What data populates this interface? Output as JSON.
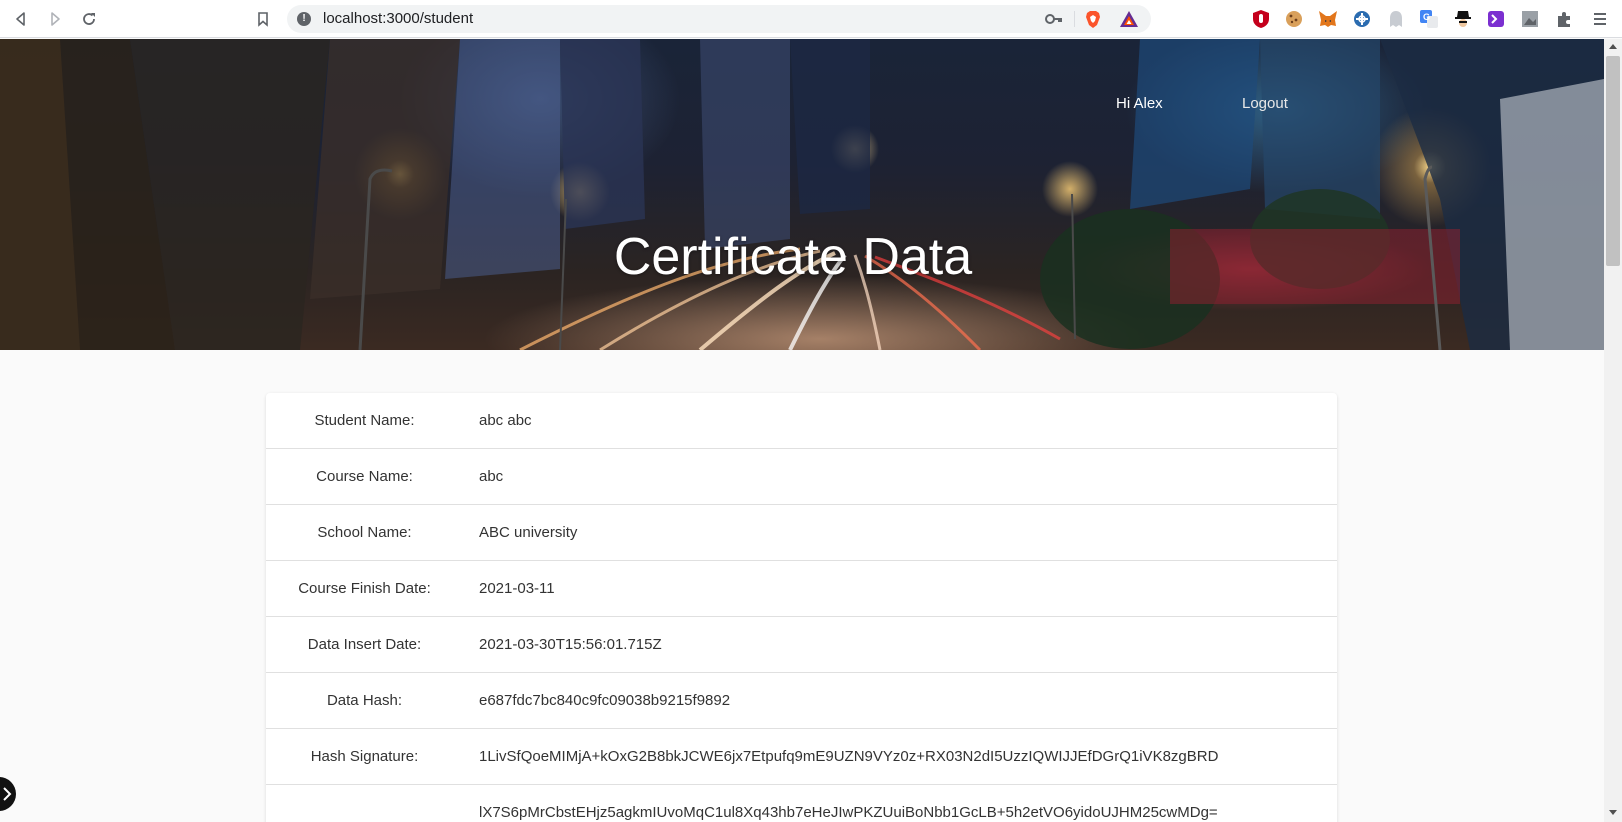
{
  "browser": {
    "url": "localhost:3000/student",
    "nav": {
      "back": "back-icon",
      "forward": "forward-icon",
      "reload": "reload-icon",
      "bookmark": "bookmark-icon"
    },
    "extensions": [
      "ublock-icon",
      "cookie-icon",
      "metamask-icon",
      "crosshair-icon",
      "ghost-icon",
      "translate-icon",
      "spy-icon",
      "terminal-icon",
      "image-icon",
      "puzzle-icon",
      "menu-icon"
    ]
  },
  "header": {
    "greeting": "Hi Alex",
    "logout": "Logout",
    "title": "Certificate Data"
  },
  "certificate": {
    "rows": [
      {
        "label": "Student Name:",
        "value": "abc abc"
      },
      {
        "label": "Course Name:",
        "value": "abc"
      },
      {
        "label": "School Name:",
        "value": "ABC university"
      },
      {
        "label": "Course Finish Date:",
        "value": "2021-03-11"
      },
      {
        "label": "Data Insert Date:",
        "value": "2021-03-30T15:56:01.715Z"
      },
      {
        "label": "Data Hash:",
        "value": "e687fdc7bc840c9fc09038b9215f9892"
      },
      {
        "label": "Hash Signature:",
        "value": "1LivSfQoeMIMjA+kOxG2B8bkJCWE6jx7Etpufq9mE9UZN9VYz0z+RX03N2dI5UzzIQWIJJEfDGrQ1iVK8zgBRD"
      },
      {
        "label": "",
        "value": "lX7S6pMrCbstEHjz5agkmIUvoMqC1ul8Xq43hb7eHeJIwPKZUuiBoNbb1GcLB+5h2etVO6yidoUJHM25cwMDg="
      }
    ]
  },
  "colors": {
    "accent": "#ffffff",
    "card_bg": "#ffffff",
    "page_bg": "#fafafa"
  }
}
